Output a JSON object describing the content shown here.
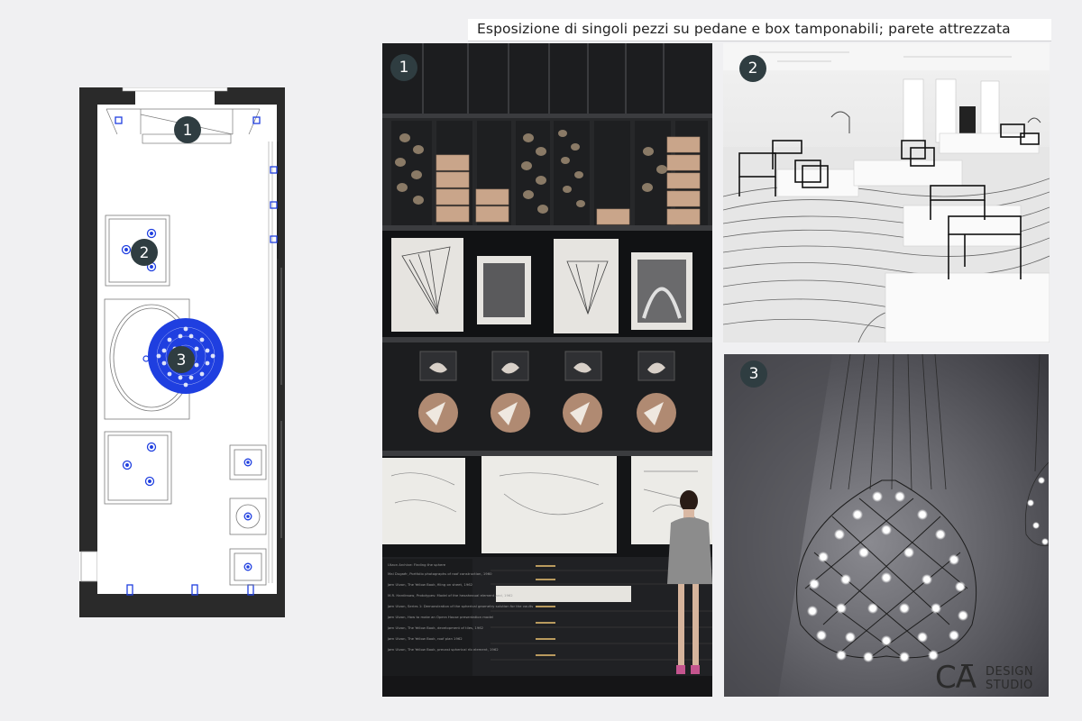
{
  "header": {
    "title": "Esposizione di singoli pezzi su pedane e box tamponabili; parete attrezzata"
  },
  "floorplan": {
    "markers": [
      "1",
      "2",
      "3"
    ]
  },
  "photos": [
    {
      "number": "1",
      "label_lines": [
        "Utzon Archive: Finding the sphere",
        "Mai Dugaér, Portfolio photographs of roof construction, 1960",
        "Jørn Utzon, The Yellow Book, filing on sheet, 1962",
        "M.R. Hardinsaw, Prototypes: Model of the hexahexual element and, 1962",
        "Jørn Utzon, Series 1: Demonstration of the spherical geometry solution for the vaults",
        "Jørn Utzon, How to make an Opera House presentation model",
        "Jørn Utzon, The Yellow Book, development of tiles, 1962",
        "Jørn Utzon, The Yellow Book, roof plan 1962",
        "Jørn Utzon, The Yellow Book, precast spherical rib element, 1962"
      ]
    },
    {
      "number": "2"
    },
    {
      "number": "3"
    }
  ],
  "logo": {
    "mark": "CA",
    "line1": "DESIGN",
    "line2": "STUDIO"
  },
  "colors": {
    "page_bg": "#f0f0f2",
    "wall": "#2a2a2a",
    "plan_accent": "#1f3fe0",
    "badge": "#2f3d41"
  }
}
